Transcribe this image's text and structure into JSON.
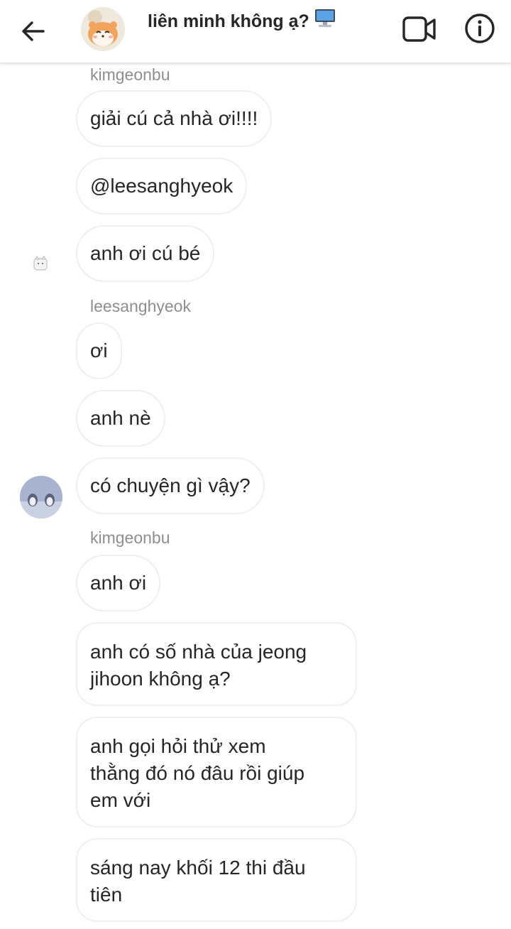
{
  "header": {
    "title": "liên minh không ạ?",
    "title_emoji": "desktop-computer-icon",
    "back_icon": "arrow-left-icon",
    "video_icon": "video-camera-icon",
    "info_icon": "info-icon",
    "avatar_icon": "hamster-avatar"
  },
  "messages": [
    {
      "sender": "kimgeonbu"
    },
    {
      "text": "giải cú cả nhà ơi!!!!"
    },
    {
      "text": "@leesanghyeok"
    },
    {
      "text": "anh ơi cú bé"
    },
    {
      "sender": "leesanghyeok"
    },
    {
      "text": "ơi"
    },
    {
      "text": "anh nè"
    },
    {
      "text": "có chuyện gì vậy?"
    },
    {
      "sender": "kimgeonbu"
    },
    {
      "text": "anh ơi"
    },
    {
      "lines": [
        "anh có số nhà của jeong",
        "jihoon không ạ?"
      ]
    },
    {
      "lines": [
        "anh gọi hỏi thử xem",
        "thằng đó nó đâu rồi giúp",
        "em với"
      ]
    },
    {
      "lines": [
        "sáng nay khối 12 thi đầu",
        "tiên"
      ]
    }
  ],
  "colors": {
    "bubble_border": "#efefef",
    "text": "#262626",
    "sender_text": "#8e8e8e",
    "background": "#ffffff"
  }
}
